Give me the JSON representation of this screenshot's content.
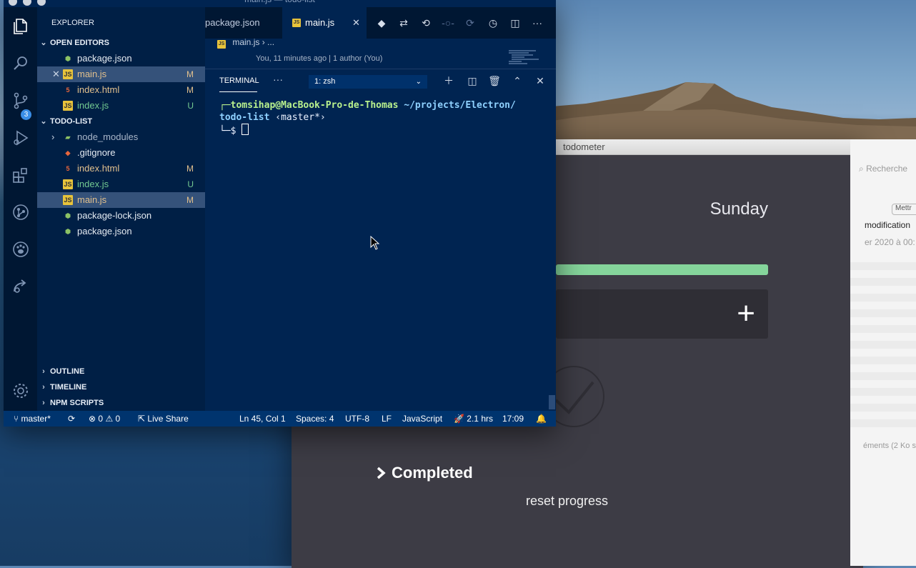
{
  "desktop": {
    "bg_color": "#21507d"
  },
  "todometer": {
    "title": "todometer",
    "day": "Sunday",
    "add_icon": "plus-icon",
    "check_icon": "check-circle-icon",
    "completed_label": "Completed",
    "reset_label": "reset progress",
    "progress_color": "#85d59b"
  },
  "finder": {
    "search_placeholder": "Recherche",
    "button_label": "Mettr",
    "column_label": "modification",
    "date_text": "er 2020 à 00:",
    "footer_text": "éments (2 Ko s"
  },
  "vscode": {
    "window_title": "main.js — todo-list",
    "explorer_title": "EXPLORER",
    "open_editors_title": "OPEN EDITORS",
    "open_editors": [
      {
        "name": "package.json",
        "icon": "json",
        "status": "",
        "selected": false
      },
      {
        "name": "main.js",
        "icon": "js",
        "status": "M",
        "selected": true
      },
      {
        "name": "index.html",
        "icon": "html",
        "status": "M",
        "selected": false
      },
      {
        "name": "index.js",
        "icon": "js",
        "status": "U",
        "selected": false
      }
    ],
    "project_title": "TODO-LIST",
    "project_files": [
      {
        "name": "node_modules",
        "icon": "folder",
        "status": ""
      },
      {
        "name": ".gitignore",
        "icon": "git",
        "status": ""
      },
      {
        "name": "index.html",
        "icon": "html",
        "status": "M"
      },
      {
        "name": "index.js",
        "icon": "js",
        "status": "U"
      },
      {
        "name": "main.js",
        "icon": "js",
        "status": "M"
      },
      {
        "name": "package-lock.json",
        "icon": "json",
        "status": ""
      },
      {
        "name": "package.json",
        "icon": "json",
        "status": ""
      }
    ],
    "outline_label": "OUTLINE",
    "timeline_label": "TIMELINE",
    "npm_label": "NPM SCRIPTS",
    "scm_badge": "3",
    "tabs": [
      {
        "label": "package.json",
        "active": false
      },
      {
        "label": "main.js",
        "active": true
      }
    ],
    "breadcrumb_file": "main.js",
    "breadcrumb_more": "...",
    "blame": "You, 11 minutes ago | 1 author (You)",
    "terminal": {
      "tab_label": "TERMINAL",
      "more_label": "···",
      "shell_select": "1: zsh",
      "user_host": "┌─tomsihap@MacBook-Pro-de-Thomas",
      "path_part1": "~/projects/Electron/",
      "path_part2": "todo-list",
      "branch": "‹master*›",
      "prompt": "└─$ "
    },
    "status": {
      "branch": "master*",
      "errors": "0",
      "warnings": "0",
      "live_share": "Live Share",
      "position": "Ln 45, Col 1",
      "spaces": "Spaces: 4",
      "encoding": "UTF-8",
      "eol": "LF",
      "language": "JavaScript",
      "time_spent": "2.1 hrs",
      "clock": "17:09"
    }
  }
}
